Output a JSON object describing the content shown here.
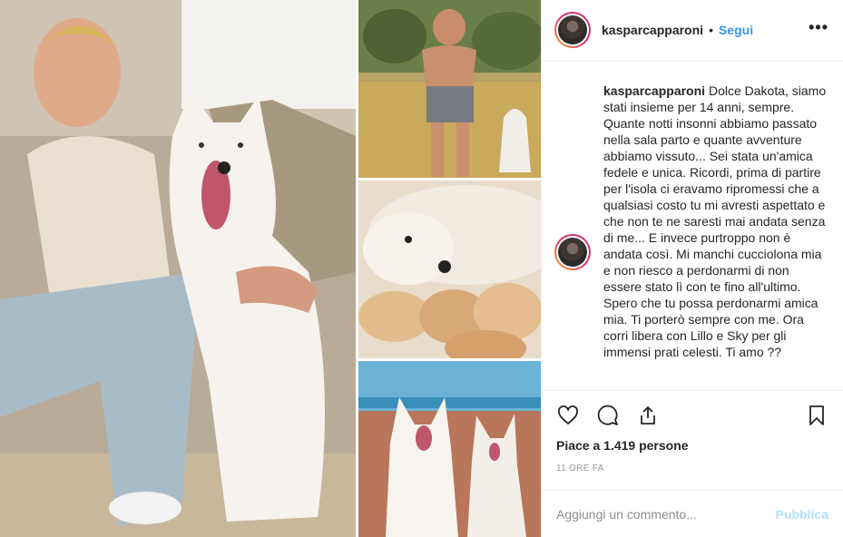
{
  "post": {
    "username": "kasparcapparoni",
    "dot": "•",
    "follow_label": "Segui",
    "more_label": "•••",
    "caption": {
      "username": "kasparcapparoni",
      "text": "Dolce Dakota, siamo stati insieme per 14 anni, sempre. Quante notti insonni abbiamo passato nella sala parto e quante avventure abbiamo vissuto... Sei stata un'amica fedele e unica. Ricordi, prima di partire per l'isola ci eravamo ripromessi che a qualsiasi costo tu mi avresti aspettato e che non te ne saresti mai andata senza di me... E invece purtroppo non è andata così. Mi manchi cucciolona mia e non riesco a perdonarmi di non essere stato lì con te fino all'ultimo. Spero che tu possa perdonarmi amica mia. Ti porterò sempre con me. Ora corri libera con Lillo e Sky per gli immensi prati celesti. Ti amo ??"
    },
    "likes": "Piace a 1.419 persone",
    "time": "11 ORE FA",
    "comment_placeholder": "Aggiungi un commento...",
    "publish_label": "Pubblica"
  },
  "icons": {
    "like": "heart-icon",
    "comment": "comment-bubble-icon",
    "share": "share-icon",
    "save": "bookmark-icon"
  },
  "colors": {
    "follow": "#3897f0",
    "publish_disabled": "#b2dffc",
    "border": "#efefef"
  }
}
